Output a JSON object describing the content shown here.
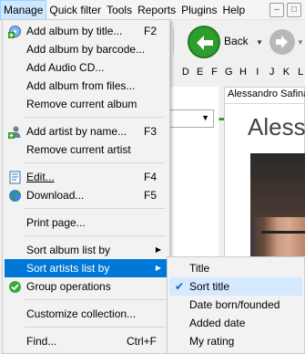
{
  "menubar": {
    "items": [
      {
        "label": "Manage"
      },
      {
        "label": "Quick filter"
      },
      {
        "label": "Tools"
      },
      {
        "label": "Reports"
      },
      {
        "label": "Plugins"
      },
      {
        "label": "Help"
      }
    ]
  },
  "toolbar": {
    "back_label": "Back"
  },
  "alphabet": [
    "D",
    "E",
    "F",
    "G",
    "H",
    "I",
    "J",
    "K",
    "L"
  ],
  "details": {
    "tab_title": "Alessandro Safina",
    "artist_heading": "Aless"
  },
  "manage_menu": {
    "items": [
      {
        "label": "Add album by title...",
        "shortcut": "F2",
        "icon": "add-album-icon"
      },
      {
        "label": "Add album by barcode..."
      },
      {
        "label": "Add Audio CD..."
      },
      {
        "label": "Add album from files..."
      },
      {
        "label": "Remove current album"
      },
      {
        "label": "Add artist by name...",
        "shortcut": "F3",
        "icon": "add-artist-icon"
      },
      {
        "label": "Remove current artist"
      },
      {
        "label": "Edit...",
        "shortcut": "F4",
        "icon": "edit-icon"
      },
      {
        "label": "Download...",
        "shortcut": "F5",
        "icon": "globe-icon"
      },
      {
        "label": "Print page..."
      },
      {
        "label": "Sort album list by"
      },
      {
        "label": "Sort artists list by"
      },
      {
        "label": "Group operations",
        "icon": "check-circle-icon"
      },
      {
        "label": "Customize collection..."
      },
      {
        "label": "Find...",
        "shortcut": "Ctrl+F"
      }
    ]
  },
  "sort_artists_submenu": {
    "items": [
      {
        "label": "Title",
        "checked": false
      },
      {
        "label": "Sort title",
        "checked": true
      },
      {
        "label": "Date born/founded",
        "checked": false
      },
      {
        "label": "Added date",
        "checked": false
      },
      {
        "label": "My rating",
        "checked": false
      }
    ]
  },
  "colors": {
    "highlight": "#0078d7",
    "menu_bg": "#f2f2f2",
    "back_button": "#2e9e2e"
  }
}
